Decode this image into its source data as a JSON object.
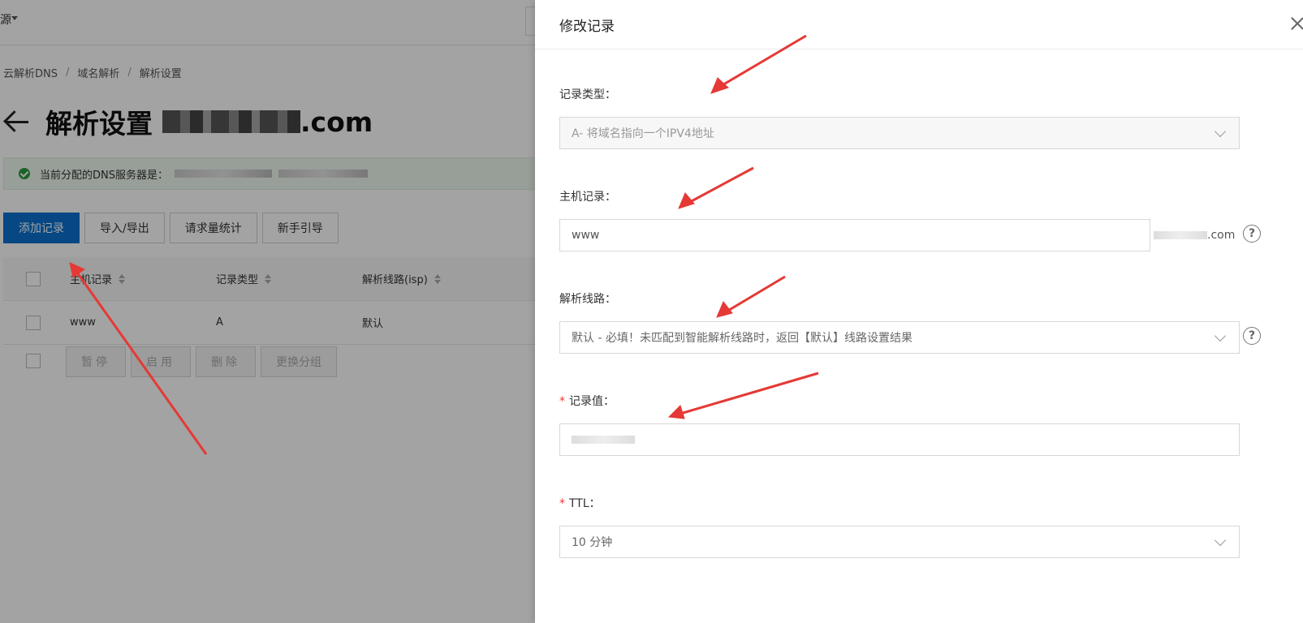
{
  "topbar": {
    "partial_label": "源"
  },
  "breadcrumb": {
    "items": [
      "云解析DNS",
      "域名解析",
      "解析设置"
    ],
    "separator": "/"
  },
  "page": {
    "title": "解析设置",
    "domain_suffix": ".com"
  },
  "alert": {
    "text": "当前分配的DNS服务器是："
  },
  "actions": {
    "add": "添加记录",
    "import_export": "导入/导出",
    "stats": "请求量统计",
    "guide": "新手引导"
  },
  "table": {
    "columns": [
      "主机记录",
      "记录类型",
      "解析线路(isp)"
    ],
    "rows": [
      {
        "host": "www",
        "type": "A",
        "line": "默认"
      }
    ]
  },
  "batch": {
    "pause": "暂停",
    "enable": "启用",
    "delete": "删除",
    "change_group": "更换分组"
  },
  "drawer": {
    "title": "修改记录",
    "record_type": {
      "label": "记录类型：",
      "value": "A- 将域名指向一个IPV4地址"
    },
    "host": {
      "label": "主机记录：",
      "value": "www",
      "suffix_end": ".com"
    },
    "line": {
      "label": "解析线路：",
      "value": "默认 - 必填！未匹配到智能解析线路时，返回【默认】线路设置结果"
    },
    "record_value": {
      "label": "记录值：",
      "required_mark": "*"
    },
    "ttl": {
      "label": "TTL：",
      "required_mark": "*",
      "value": "10 分钟"
    },
    "help_glyph": "?"
  },
  "colors": {
    "primary": "#0a6fcf",
    "arrow": "#e53935",
    "required": "#e33333"
  }
}
